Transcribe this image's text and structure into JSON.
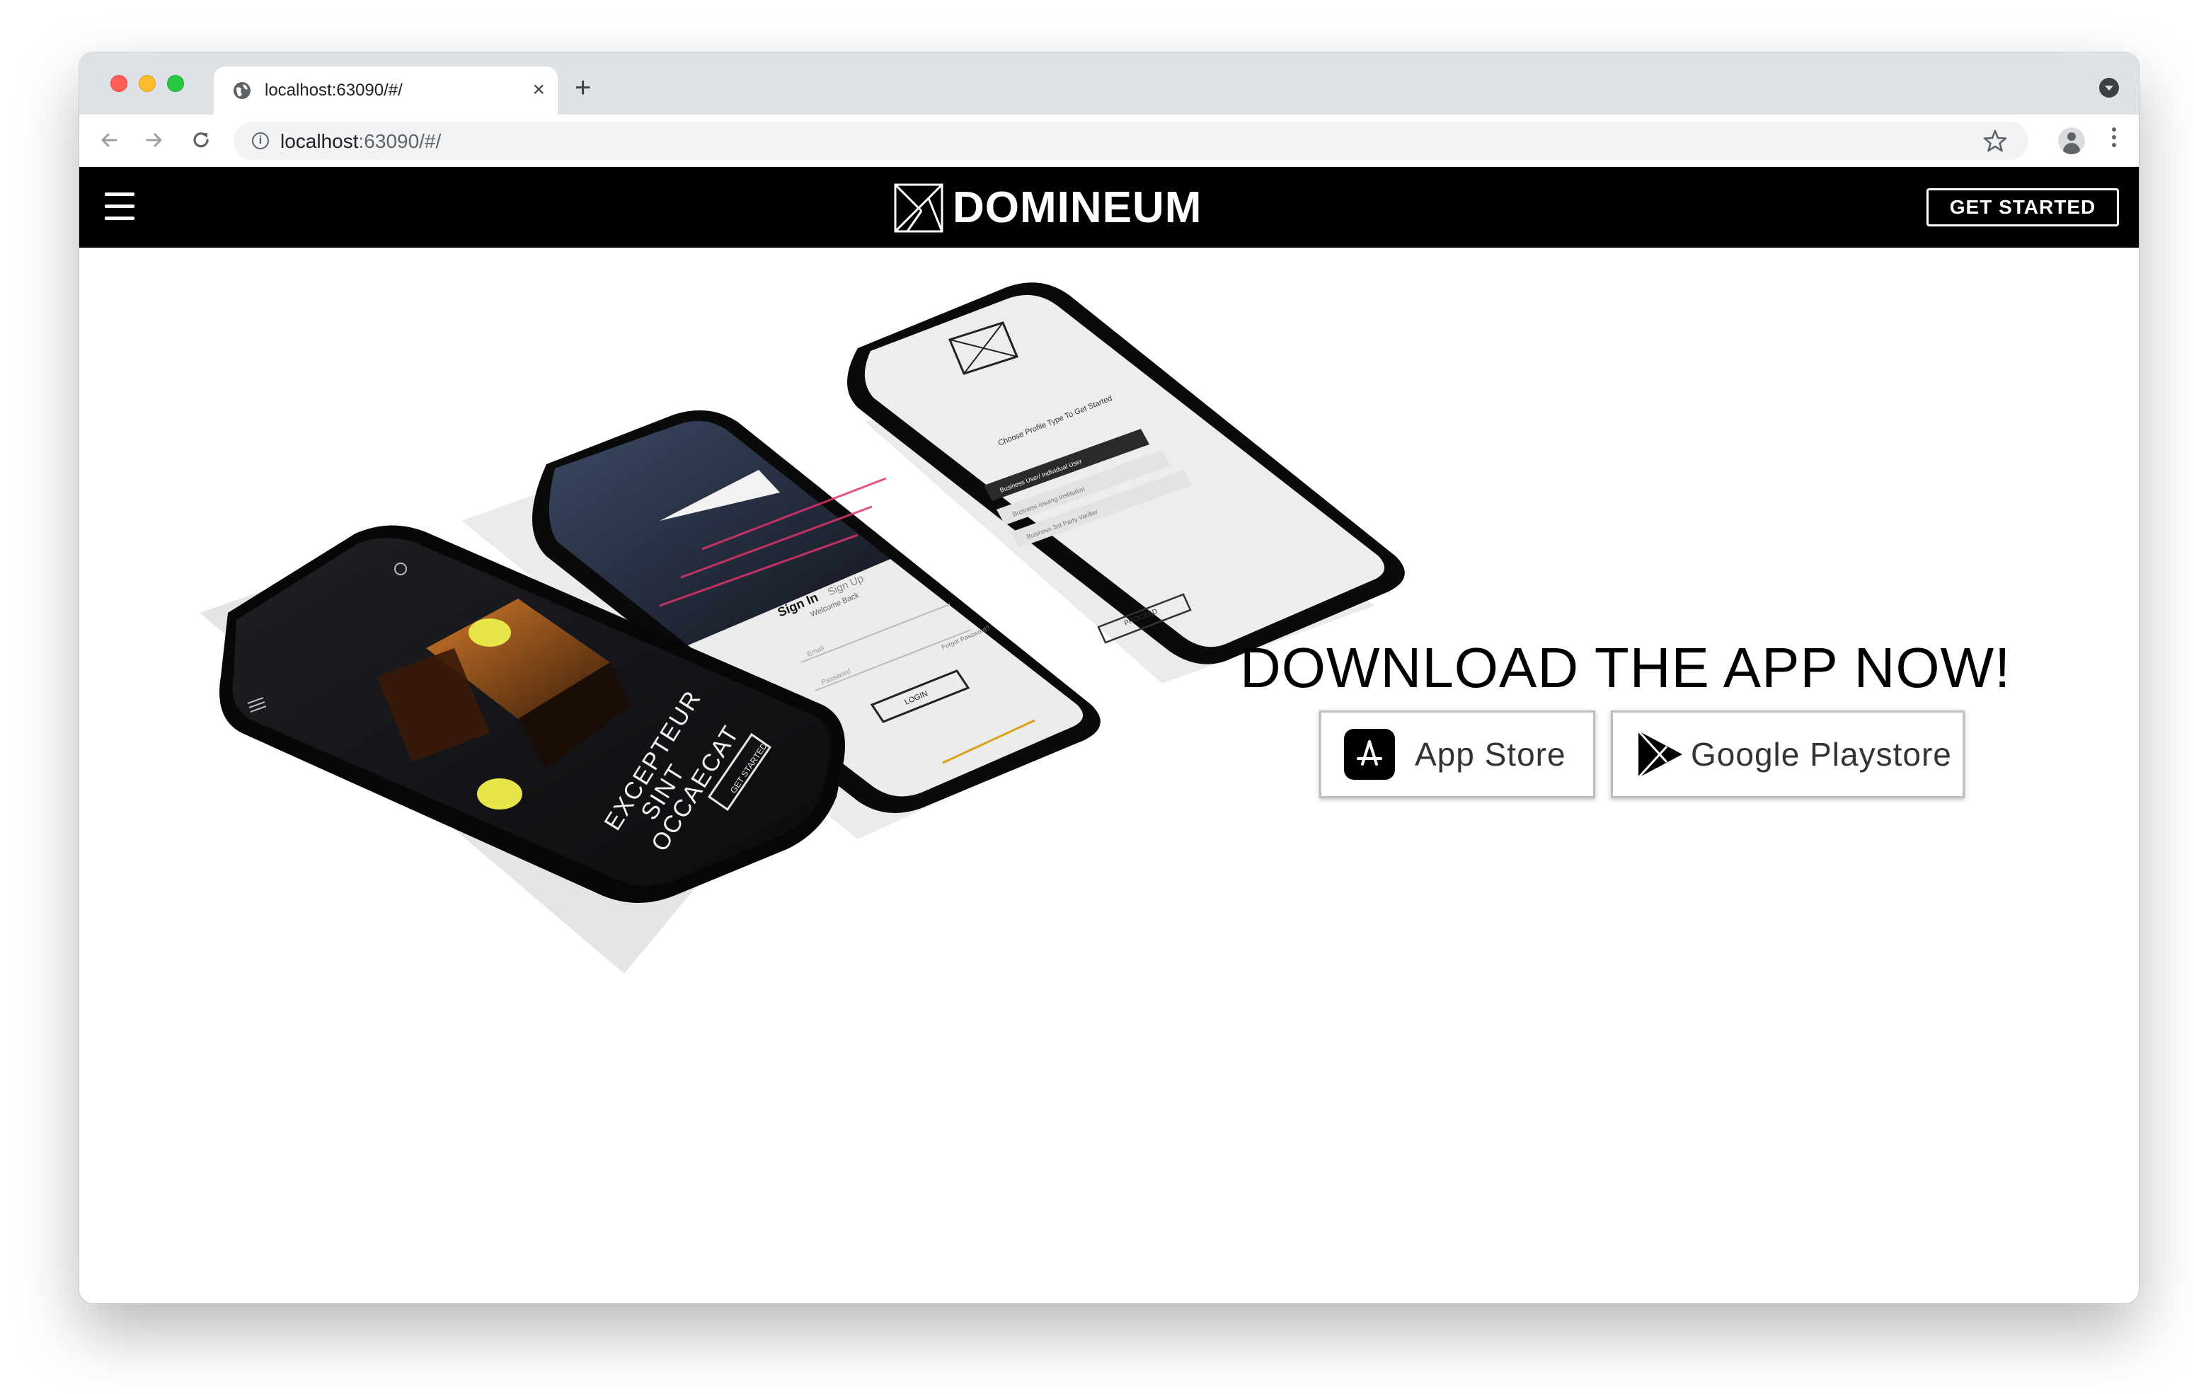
{
  "browser": {
    "tab_title": "localhost:63090/#/",
    "new_tab_glyph": "+",
    "close_tab_glyph": "×",
    "url_host": "localhost",
    "url_rest": ":63090/#/",
    "icons": [
      "globe-icon",
      "back-arrow-icon",
      "forward-arrow-icon",
      "reload-icon",
      "info-icon",
      "star-icon",
      "profile-icon",
      "kebab-menu-icon",
      "tab-search-icon"
    ]
  },
  "site": {
    "brand_name": "DOMINEUM",
    "cta_label": "GET STARTED",
    "menu_icon": "hamburger-icon",
    "headline": "DOWNLOAD THE APP NOW!",
    "app_store_label": "App Store",
    "google_play_label": "Google Playstore"
  },
  "phones": {
    "front": {
      "lines": [
        "EXCEPTEUR",
        "SINT",
        "OCCAECAT"
      ],
      "button": "GET STARTED"
    },
    "middle": {
      "tab_sign_in": "Sign In",
      "tab_sign_up": "Sign Up",
      "welcome": "Welcome Back",
      "email_placeholder": "Email",
      "password_placeholder": "Password",
      "forgot": "Forgot Password?",
      "login": "LOGIN"
    },
    "back": {
      "prompt": "Choose Profile Type To Get Started",
      "options": [
        "Business User/ Individual User",
        "Business issuing Institution",
        "Business 3rd Party Verifier"
      ],
      "proceed": "PROCEED"
    }
  },
  "colors": {
    "brand_black": "#000000",
    "accent_yellow": "#e8e54a",
    "accent_orange": "#c76a1e",
    "accent_pink": "#e0336b"
  }
}
